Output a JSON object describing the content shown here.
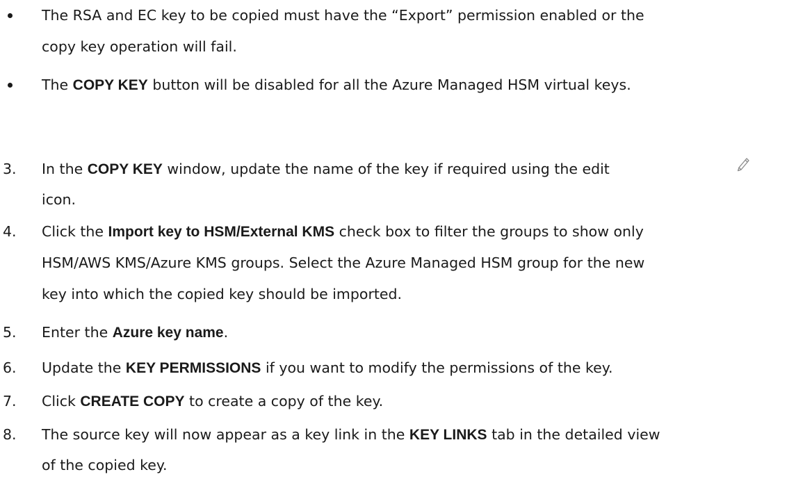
{
  "bullets": [
    {
      "line1": "The RSA and EC key to be copied must have the “Export” permission enabled or the",
      "line2": "copy key operation will fail."
    },
    {
      "pre": "The ",
      "bold": "COPY KEY",
      "post": " button will be disabled for all the Azure Managed HSM virtual keys."
    }
  ],
  "steps": [
    {
      "num": "3.",
      "pre": "In the ",
      "bold": "COPY KEY",
      "post": " window, update the name of the key if required using the edit",
      "line2": "icon.",
      "icon": "pencil-edit-icon"
    },
    {
      "num": "4.",
      "pre": "Click the ",
      "bold": "Import key to HSM/External KMS",
      "post": " check box to filter the groups to show only",
      "line2": "HSM/AWS KMS/Azure KMS groups. Select the Azure Managed HSM group for the new",
      "line3": "key into which the copied key should be imported."
    },
    {
      "num": "5.",
      "pre": "Enter the ",
      "bold": "Azure key name",
      "post": "."
    },
    {
      "num": "6.",
      "pre": "Update the ",
      "bold": "KEY PERMISSIONS",
      "post": " if you want to modify the permissions of the key."
    },
    {
      "num": "7.",
      "pre": "Click ",
      "bold": "CREATE COPY",
      "post": " to create a copy of the key."
    },
    {
      "num": "8.",
      "pre": "The source key will now appear as a key link in the ",
      "bold": "KEY LINKS",
      "post": " tab in the detailed view",
      "line2": "of the copied key."
    }
  ]
}
